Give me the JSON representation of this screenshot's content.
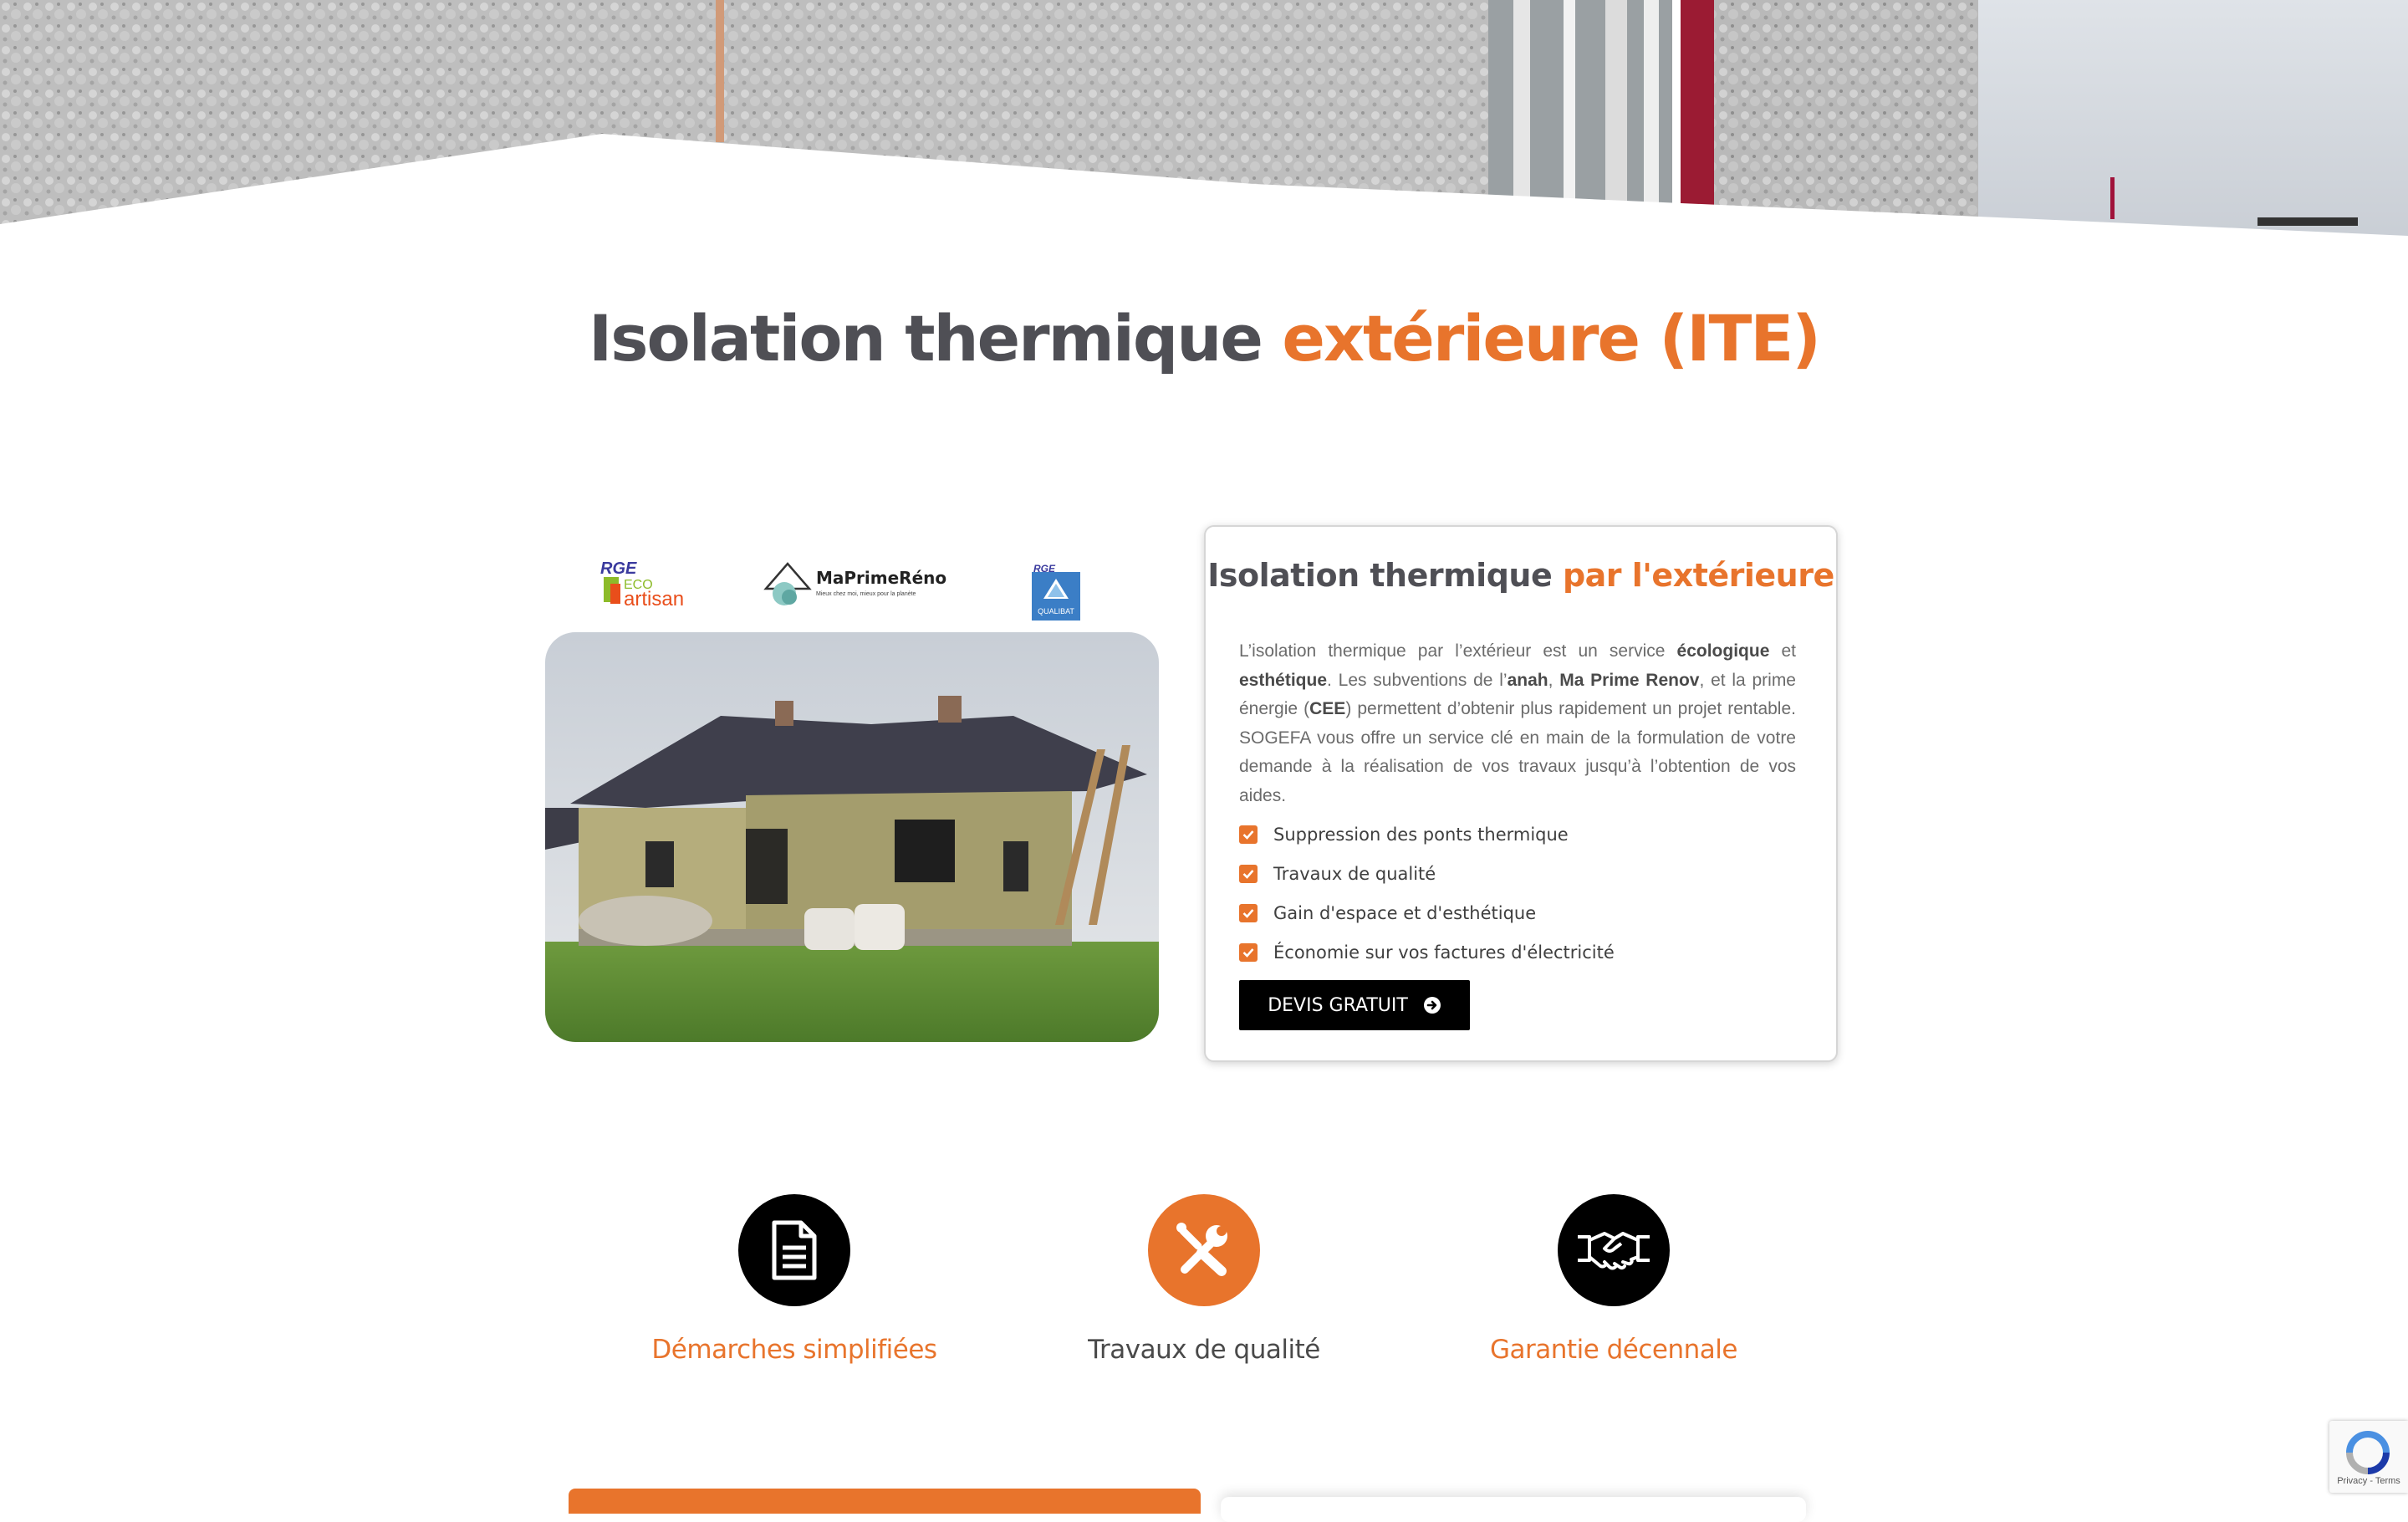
{
  "page": {
    "title_main": "Isolation thermique ",
    "title_accent": "extérieure (ITE)"
  },
  "logos": {
    "rge_eco_artisan": {
      "top": "RGE",
      "line1": "ECO",
      "line2": "artisan"
    },
    "maprimerenov": {
      "name": "MaPrimeRénov'",
      "tagline": "Mieux chez moi, mieux pour la planète"
    },
    "qualibat": {
      "top": "RGE",
      "name": "QUALIBAT"
    }
  },
  "card": {
    "title_main": "Isolation thermique ",
    "title_accent": "par l'extérieure",
    "text": {
      "p1": "L’isolation thermique par l’extérieur est un service ",
      "b1": "écologique",
      "p2": " et ",
      "b2": "esthétique",
      "p3": ". Les subventions de l’",
      "b3": "anah",
      "p4": ", ",
      "b4": "Ma Prime Renov",
      "p5": ", et la prime énergie (",
      "b5": "CEE",
      "p6": ") permettent d’obtenir plus rapidement un projet rentable. SOGEFA vous offre un service clé en main de la formulation de votre demande à la réalisation de vos travaux jusqu’à l’obtention de vos aides."
    },
    "checklist": [
      "Suppression des ponts thermique",
      "Travaux de qualité",
      "Gain d'espace et d'esthétique",
      "Économie sur vos factures d'électricité"
    ],
    "button_label": "DEVIS GRATUIT"
  },
  "features": [
    {
      "label": "Démarches simplifiées",
      "icon": "document-icon",
      "circle_color": "#000000",
      "label_color": "#e8742c"
    },
    {
      "label": "Travaux de qualité",
      "icon": "tools-icon",
      "circle_color": "#e8742c",
      "label_color": "#4a4a4a"
    },
    {
      "label": "Garantie décennale",
      "icon": "handshake-icon",
      "circle_color": "#000000",
      "label_color": "#e8742c"
    }
  ],
  "recaptcha": {
    "links": "Privacy - Terms"
  },
  "colors": {
    "accent": "#e8742c",
    "heading": "#4f4f55",
    "button": "#000000"
  }
}
